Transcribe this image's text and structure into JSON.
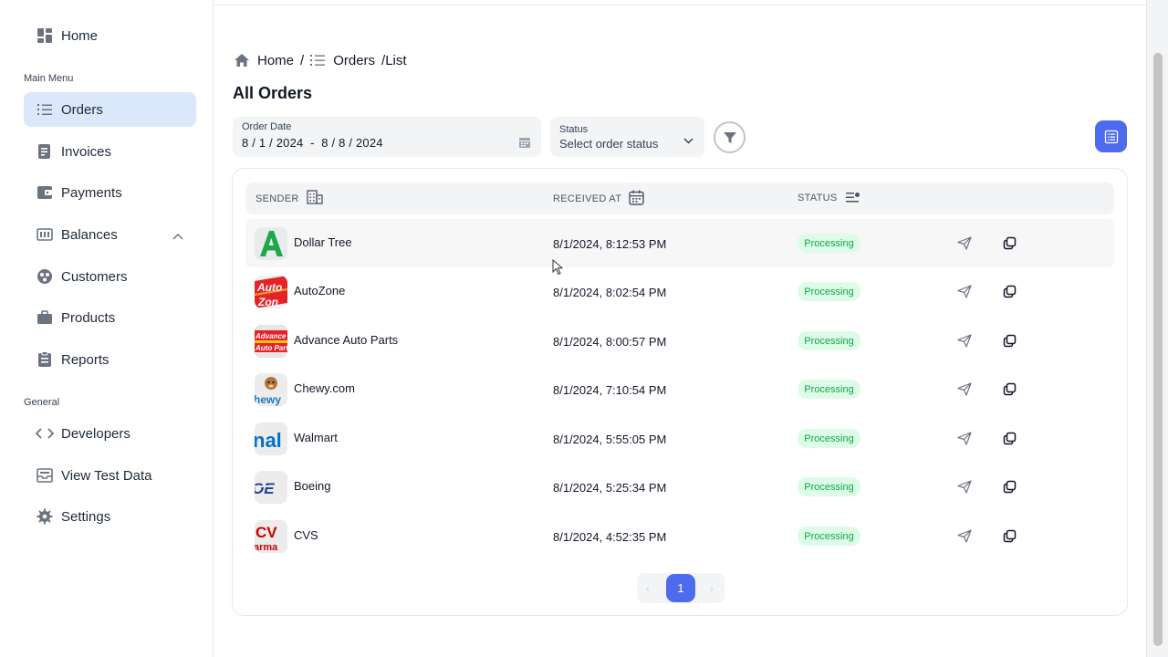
{
  "sidebar": {
    "home": "Home",
    "main_menu_label": "Main Menu",
    "general_label": "General",
    "items": [
      {
        "label": "Orders",
        "icon": "list-icon"
      },
      {
        "label": "Invoices",
        "icon": "invoice-icon"
      },
      {
        "label": "Payments",
        "icon": "wallet-icon"
      },
      {
        "label": "Balances",
        "icon": "balance-icon"
      },
      {
        "label": "Customers",
        "icon": "customers-icon"
      },
      {
        "label": "Products",
        "icon": "briefcase-icon"
      },
      {
        "label": "Reports",
        "icon": "clipboard-icon"
      }
    ],
    "general_items": [
      {
        "label": "Developers",
        "icon": "code-icon"
      },
      {
        "label": "View Test Data",
        "icon": "inbox-icon"
      },
      {
        "label": "Settings",
        "icon": "gear-icon"
      }
    ]
  },
  "breadcrumb": {
    "home": "Home",
    "sep": "/",
    "orders": "Orders",
    "list": "/List"
  },
  "page_title": "All Orders",
  "filters": {
    "date_label": "Order Date",
    "date_value": "8 / 1 / 2024  -  8 / 8 / 2024",
    "status_label": "Status",
    "status_placeholder": "Select order status"
  },
  "table": {
    "headers": {
      "sender": "SENDER",
      "received": "RECEIVED AT",
      "status": "STATUS"
    },
    "rows": [
      {
        "sender": "Dollar Tree",
        "received": "8/1/2024, 8:12:53 PM",
        "status": "Processing"
      },
      {
        "sender": "AutoZone",
        "received": "8/1/2024, 8:02:54 PM",
        "status": "Processing"
      },
      {
        "sender": "Advance Auto Parts",
        "received": "8/1/2024, 8:00:57 PM",
        "status": "Processing"
      },
      {
        "sender": "Chewy.com",
        "received": "8/1/2024, 7:10:54 PM",
        "status": "Processing"
      },
      {
        "sender": "Walmart",
        "received": "8/1/2024, 5:55:05 PM",
        "status": "Processing"
      },
      {
        "sender": "Boeing",
        "received": "8/1/2024, 5:25:34 PM",
        "status": "Processing"
      },
      {
        "sender": "CVS",
        "received": "8/1/2024, 4:52:35 PM",
        "status": "Processing"
      }
    ]
  },
  "pagination": {
    "prev": "‹",
    "page": "1",
    "next": "›"
  },
  "colors": {
    "accent": "#4f6bed",
    "active_nav": "#dbe8fb",
    "status_bg": "#dcfce7",
    "status_text": "#16a34a"
  }
}
